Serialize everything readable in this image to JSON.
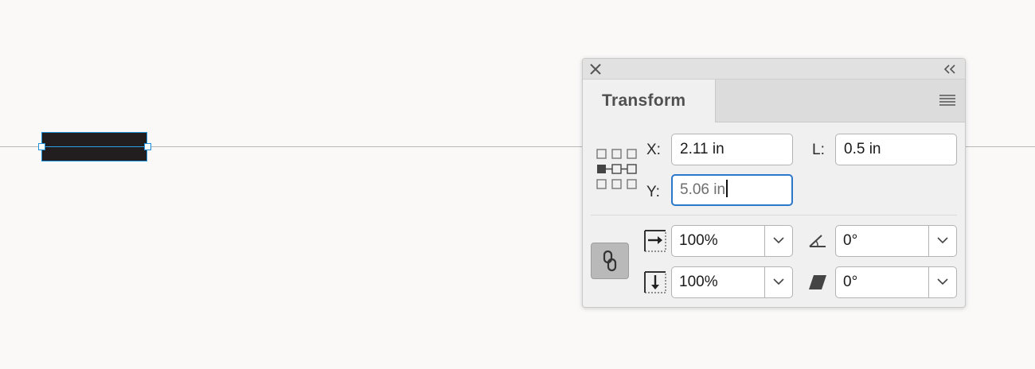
{
  "panel": {
    "tab_label": "Transform",
    "fields": {
      "x_label": "X:",
      "x_value": "2.11 in",
      "y_label": "Y:",
      "y_value": "5.06 in",
      "l_label": "L:",
      "l_value": "0.5 in"
    },
    "scale": {
      "horizontal_value": "100%",
      "vertical_value": "100%"
    },
    "rotate": {
      "value": "0°"
    },
    "shear": {
      "value": "0°"
    }
  },
  "colors": {
    "selection_blue": "#1d8fd6",
    "focus_blue": "#2b77c9",
    "shape_fill": "#221e1f"
  },
  "icons": {
    "close": "close-icon",
    "collapse": "double-chevron-left-icon",
    "menu": "hamburger-menu-icon",
    "reference_point": "reference-point-grid-icon",
    "constrain": "link-chain-icon",
    "scale_h": "scale-horizontal-icon",
    "scale_v": "scale-vertical-icon",
    "rotate": "rotate-angle-icon",
    "shear": "shear-icon",
    "dropdown": "chevron-down-icon"
  }
}
